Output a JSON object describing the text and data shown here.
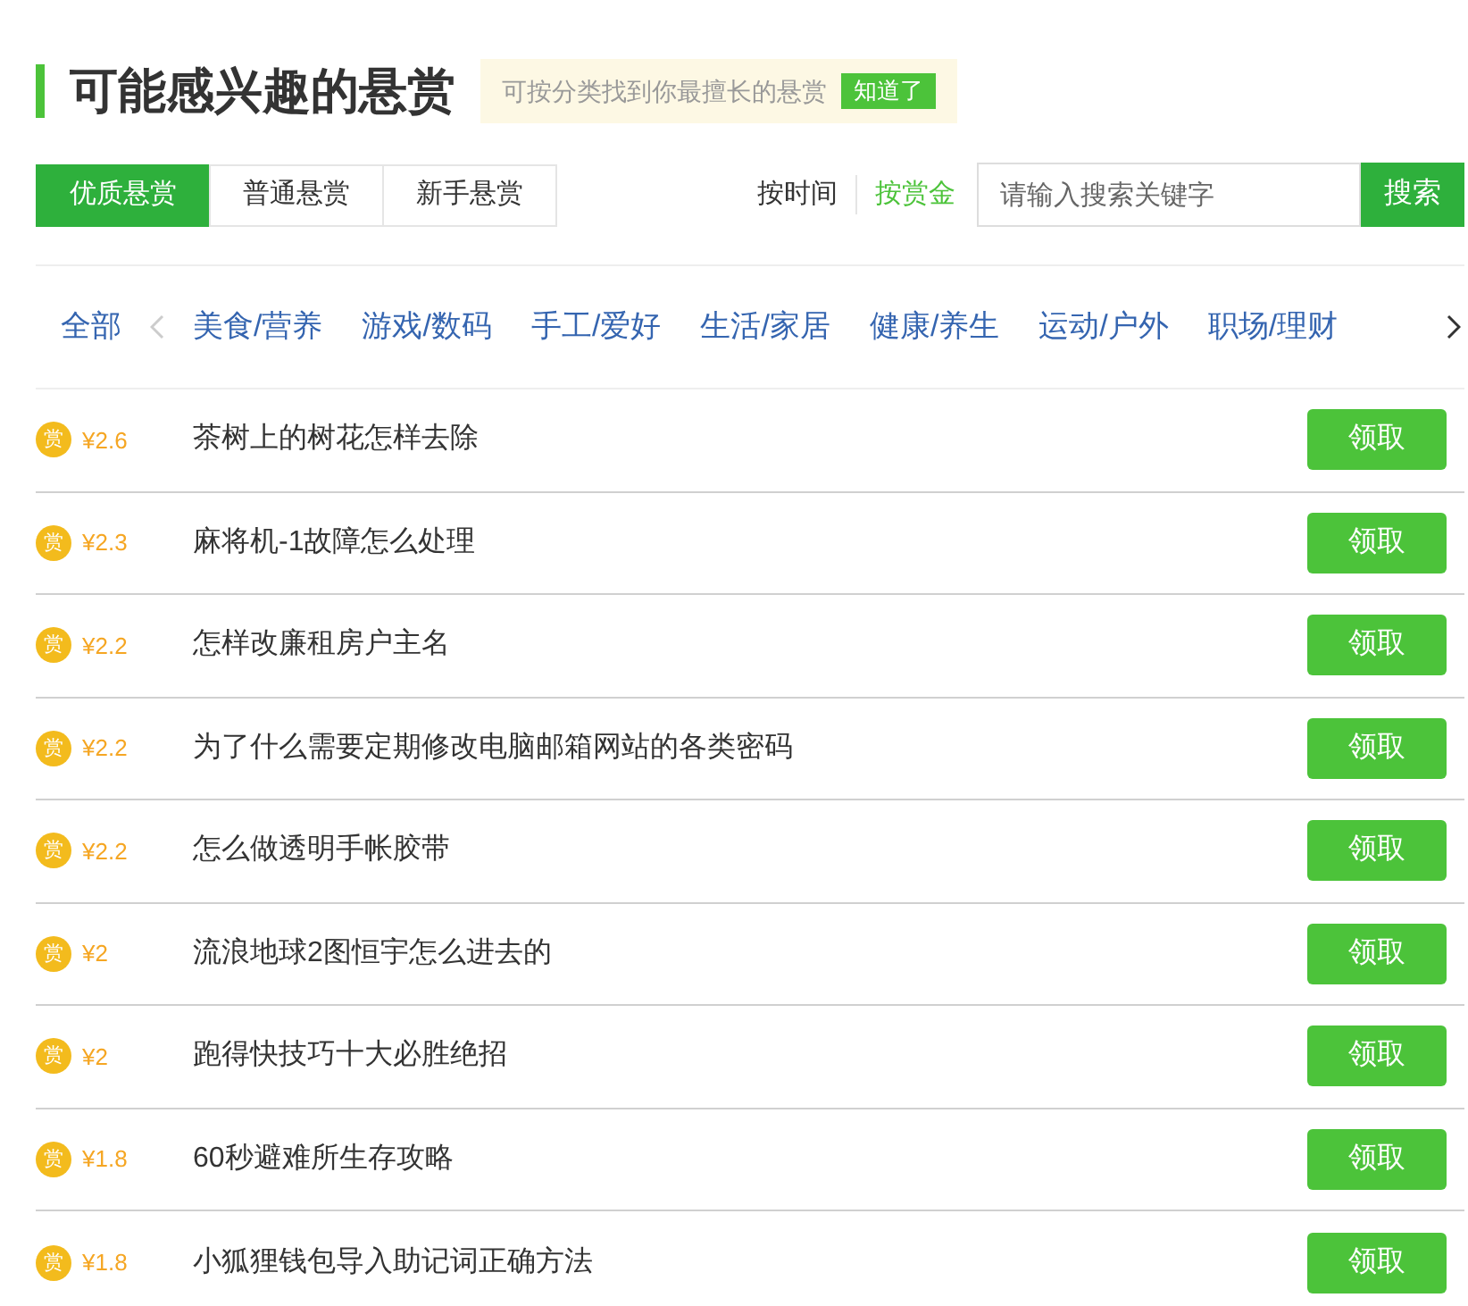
{
  "title": "可能感兴趣的悬赏",
  "tip": {
    "text": "可按分类找到你最擅长的悬赏",
    "button": "知道了"
  },
  "tabs": [
    {
      "label": "优质悬赏",
      "selected": true
    },
    {
      "label": "普通悬赏",
      "selected": false
    },
    {
      "label": "新手悬赏",
      "selected": false
    }
  ],
  "sort": [
    {
      "label": "按时间",
      "selected": false
    },
    {
      "label": "按赏金",
      "selected": true
    }
  ],
  "search": {
    "placeholder": "请输入搜索关键字",
    "button": "搜索"
  },
  "categories": {
    "all": "全部",
    "items": [
      "美食/营养",
      "游戏/数码",
      "手工/爱好",
      "生活/家居",
      "健康/养生",
      "运动/户外",
      "职场/理财"
    ]
  },
  "rows": [
    {
      "coin": "赏",
      "reward": "¥2.6",
      "question": "茶树上的树花怎样去除",
      "button": "领取"
    },
    {
      "coin": "赏",
      "reward": "¥2.3",
      "question": "麻将机-1故障怎么处理",
      "button": "领取"
    },
    {
      "coin": "赏",
      "reward": "¥2.2",
      "question": "怎样改廉租房户主名",
      "button": "领取"
    },
    {
      "coin": "赏",
      "reward": "¥2.2",
      "question": "为了什么需要定期修改电脑邮箱网站的各类密码",
      "button": "领取"
    },
    {
      "coin": "赏",
      "reward": "¥2.2",
      "question": "怎么做透明手帐胶带",
      "button": "领取"
    },
    {
      "coin": "赏",
      "reward": "¥2",
      "question": "流浪地球2图恒宇怎么进去的",
      "button": "领取"
    },
    {
      "coin": "赏",
      "reward": "¥2",
      "question": "跑得快技巧十大必胜绝招",
      "button": "领取"
    },
    {
      "coin": "赏",
      "reward": "¥1.8",
      "question": "60秒避难所生存攻略",
      "button": "领取"
    },
    {
      "coin": "赏",
      "reward": "¥1.8",
      "question": "小狐狸钱包导入助记词正确方法",
      "button": "领取"
    }
  ]
}
